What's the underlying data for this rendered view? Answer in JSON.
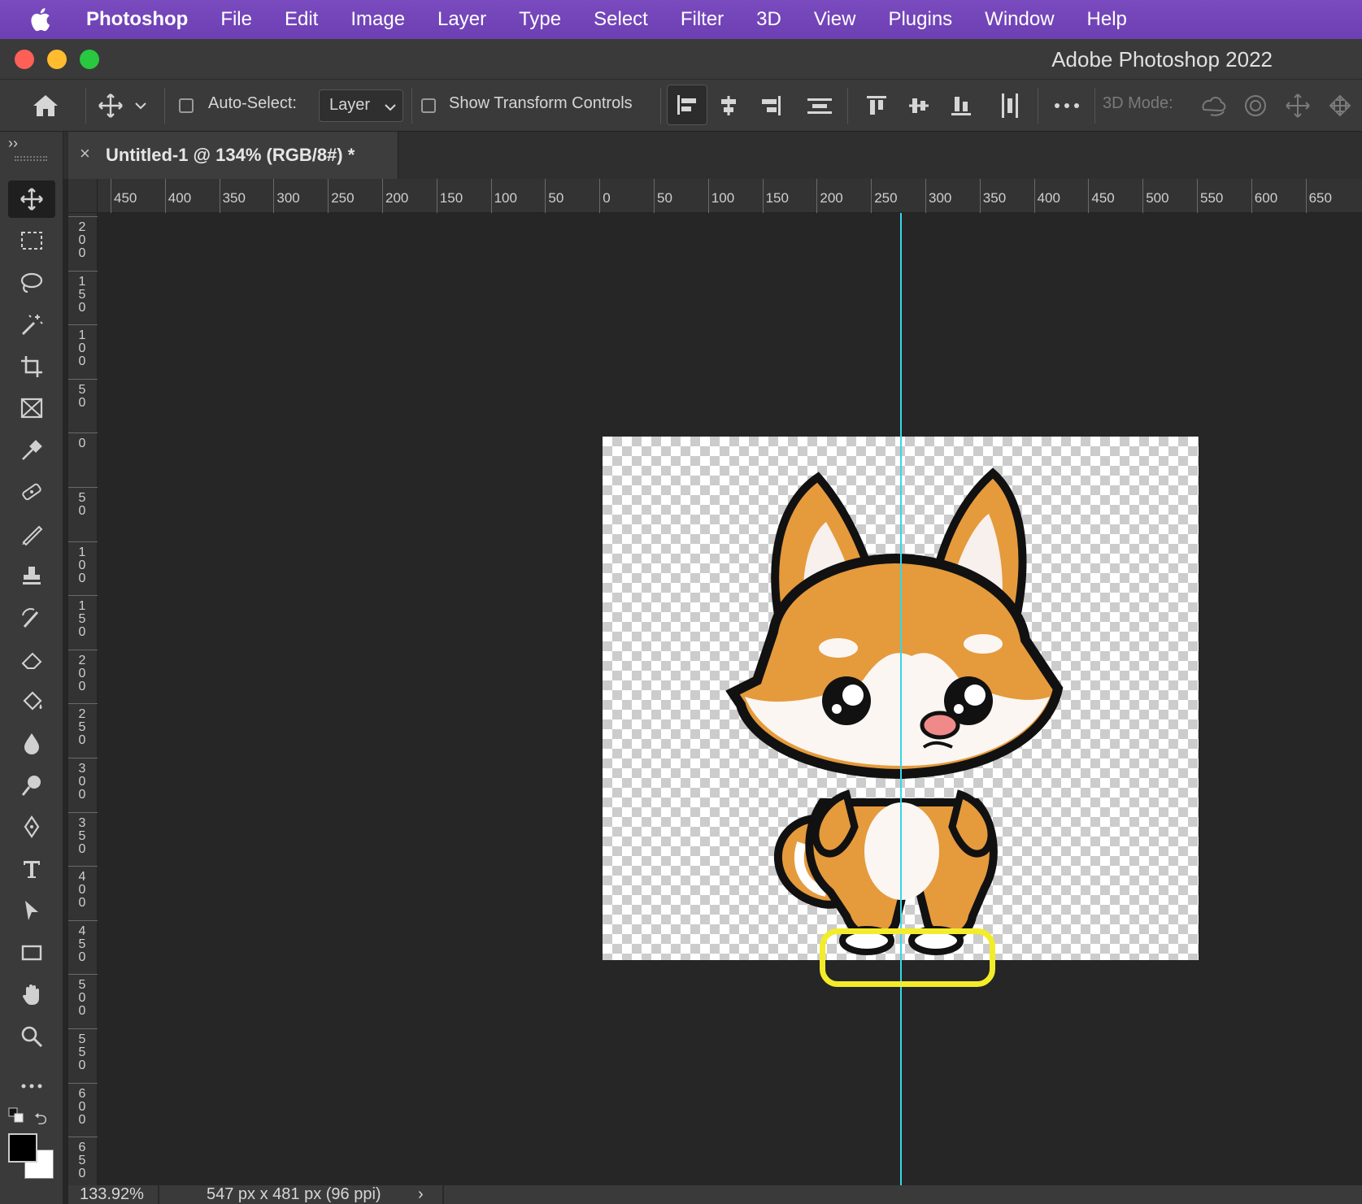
{
  "menubar": {
    "app_name": "Photoshop",
    "items": [
      "File",
      "Edit",
      "Image",
      "Layer",
      "Type",
      "Select",
      "Filter",
      "3D",
      "View",
      "Plugins",
      "Window",
      "Help"
    ]
  },
  "window": {
    "title": "Adobe Photoshop 2022"
  },
  "options_bar": {
    "auto_select_label": "Auto-Select:",
    "auto_select_value": "Layer",
    "show_transform_label": "Show Transform Controls",
    "mode_3d_label": "3D Mode:"
  },
  "document_tab": {
    "title": "Untitled-1 @ 134% (RGB/8#) *",
    "close": "×"
  },
  "ruler_h": [
    "450",
    "400",
    "350",
    "300",
    "250",
    "200",
    "150",
    "100",
    "50",
    "0",
    "50",
    "100",
    "150",
    "200",
    "250",
    "300",
    "350",
    "400",
    "450",
    "500",
    "550",
    "600",
    "650"
  ],
  "ruler_v": [
    "200",
    "150",
    "100",
    "50",
    "0",
    "50",
    "100",
    "150",
    "200",
    "250",
    "300",
    "350",
    "400",
    "450",
    "500",
    "550",
    "600",
    "650"
  ],
  "tools": [
    "move-tool",
    "marquee-tool",
    "lasso-tool",
    "magic-wand-tool",
    "crop-tool",
    "frame-tool",
    "eyedropper-tool",
    "healing-tool",
    "brush-tool",
    "stamp-tool",
    "history-brush-tool",
    "eraser-tool",
    "paint-bucket-tool",
    "blur-tool",
    "dodge-tool",
    "pen-tool",
    "type-tool",
    "path-select-tool",
    "rectangle-tool",
    "hand-tool",
    "zoom-tool",
    "more-tools"
  ],
  "colors": {
    "foreground": "#000000",
    "background": "#ffffff",
    "guide": "#38d6e8",
    "highlight": "#f3ec2a",
    "menubar": "#6c3fb3"
  },
  "status": {
    "zoom": "133.92%",
    "doc_info": "547 px x 481 px (96 ppi)",
    "arrow": "›"
  }
}
